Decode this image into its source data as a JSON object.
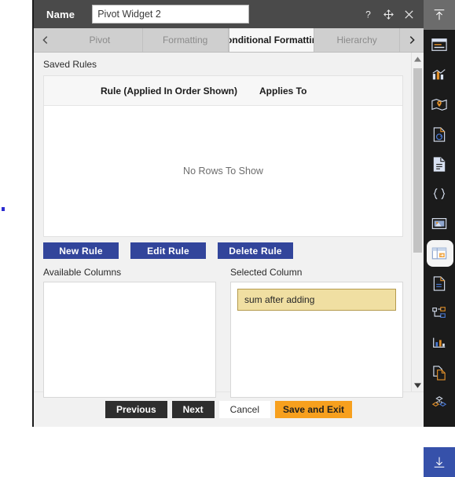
{
  "titlebar": {
    "label": "Name",
    "name_value": "Pivot Widget 2",
    "name_placeholder": "Name",
    "help_icon": "question-mark-icon",
    "move_icon": "move-icon",
    "close_icon": "close-icon"
  },
  "tabs": {
    "prev_arrow": "chevron-left-icon",
    "next_arrow": "chevron-right-icon",
    "items": [
      {
        "label": "Pivot",
        "active": false
      },
      {
        "label": "Formatting",
        "active": false
      },
      {
        "label": "Conditional Formatting",
        "active": true
      },
      {
        "label": "Hierarchy",
        "active": false
      }
    ]
  },
  "main": {
    "saved_rules_label": "Saved Rules",
    "grid": {
      "columns": [
        "Rule (Applied In Order Shown)",
        "Applies To"
      ],
      "rows": [],
      "empty_message": "No Rows To Show"
    },
    "rule_buttons": [
      {
        "label": "New Rule"
      },
      {
        "label": "Edit Rule"
      },
      {
        "label": "Delete Rule"
      }
    ],
    "available_columns": {
      "title": "Available Columns",
      "items": []
    },
    "selected_column": {
      "title": "Selected Column",
      "items": [
        {
          "label": "sum after adding"
        }
      ]
    }
  },
  "footer": {
    "previous": "Previous",
    "next": "Next",
    "cancel": "Cancel",
    "save_and_exit": "Save and Exit"
  },
  "rail": {
    "items": [
      {
        "name": "export-up-icon",
        "state": "top-active"
      },
      {
        "name": "widget-panel-icon",
        "state": ""
      },
      {
        "name": "bar-chart-icon",
        "state": ""
      },
      {
        "name": "map-pin-icon",
        "state": ""
      },
      {
        "name": "document-refresh-icon",
        "state": ""
      },
      {
        "name": "document-lines-icon",
        "state": ""
      },
      {
        "name": "braces-icon",
        "state": ""
      },
      {
        "name": "image-icon",
        "state": ""
      },
      {
        "name": "pivot-table-icon",
        "state": "pill-active"
      },
      {
        "name": "document-text-icon",
        "state": ""
      },
      {
        "name": "tree-nodes-icon",
        "state": ""
      },
      {
        "name": "line-chart-icon",
        "state": ""
      },
      {
        "name": "copy-pages-icon",
        "state": ""
      },
      {
        "name": "cubes-icon",
        "state": ""
      },
      {
        "name": "rx-prescription-icon",
        "state": ""
      },
      {
        "name": "download-icon",
        "state": "blue-active"
      }
    ]
  },
  "colors": {
    "titlebar_bg": "#4a4a4a",
    "tab_bg": "#cfcfcf",
    "tab_active_bg": "#f7f7f7",
    "rule_button_bg": "#32459b",
    "chip_bg": "#f0dfa2",
    "chip_border": "#b49a4c",
    "save_button_bg": "#f7a01e",
    "rail_bg": "#1b1b1b",
    "rail_active_bg": "#3651aa"
  }
}
